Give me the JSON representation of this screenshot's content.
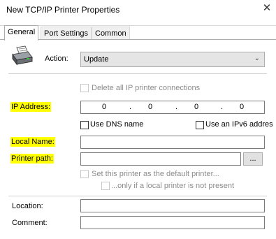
{
  "window": {
    "title": "New TCP/IP Printer Properties",
    "close_glyph": "✕"
  },
  "tabs": [
    {
      "label": "General",
      "active": true
    },
    {
      "label": "Port Settings",
      "active": false
    },
    {
      "label": "Common",
      "active": false
    }
  ],
  "action": {
    "label": "Action:",
    "value": "Update",
    "icon": "printer-icon"
  },
  "delete_all": {
    "label": "Delete all IP printer connections",
    "checked": false,
    "enabled": false
  },
  "ip": {
    "label": "IP Address:",
    "octets": [
      "0",
      "0",
      "0",
      "0"
    ],
    "dot": "."
  },
  "use_dns": {
    "label": "Use DNS name",
    "checked": false
  },
  "use_ipv6": {
    "label": "Use an IPv6 addres",
    "checked": false
  },
  "local_name": {
    "label": "Local Name:",
    "value": ""
  },
  "printer_path": {
    "label": "Printer path:",
    "value": "",
    "browse_label": "..."
  },
  "set_default": {
    "label": "Set this printer as the default printer...",
    "checked": false,
    "enabled": false
  },
  "only_if_local": {
    "label": "...only if a local printer is not present",
    "checked": false,
    "enabled": false
  },
  "location": {
    "label": "Location:",
    "value": ""
  },
  "comment": {
    "label": "Comment:",
    "value": ""
  },
  "colors": {
    "highlight": "#ffff00",
    "disabled_text": "#8c8c8c"
  }
}
